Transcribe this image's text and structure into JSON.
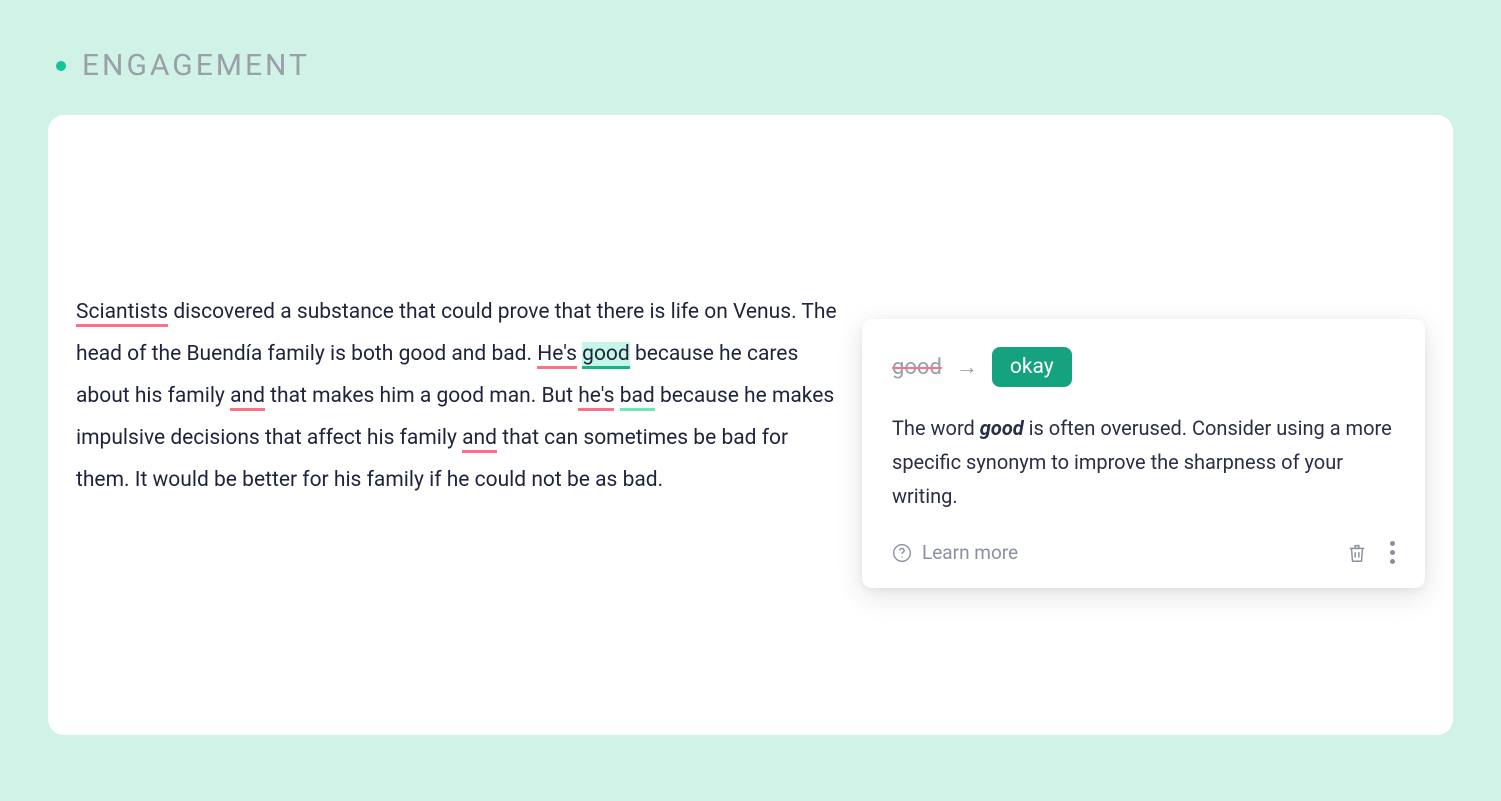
{
  "section": {
    "title": "ENGAGEMENT"
  },
  "editor": {
    "segments": {
      "s1": "Sciantists",
      "s2": " discovered a substance that could prove that there is life on Venus. The head of the Buendía family is both good and bad. ",
      "s3": "He's",
      "s4": " ",
      "s5": "good",
      "s6": " because he cares about his family ",
      "s7": "and",
      "s8": " that makes him a good man. But ",
      "s9": "he's",
      "s10": " ",
      "s11": "bad",
      "s12": " because he makes impulsive decisions that affect his family ",
      "s13": "and",
      "s14": " that can sometimes be bad for them. It would be better for his family if he could not be as bad."
    }
  },
  "suggestion": {
    "original": "good",
    "replacement": "okay",
    "desc_prefix": "The word ",
    "desc_bold": "good",
    "desc_suffix": " is often overused. Consider using a more specific synonym to improve the sharpness of your writing.",
    "learn_more": "Learn more"
  }
}
